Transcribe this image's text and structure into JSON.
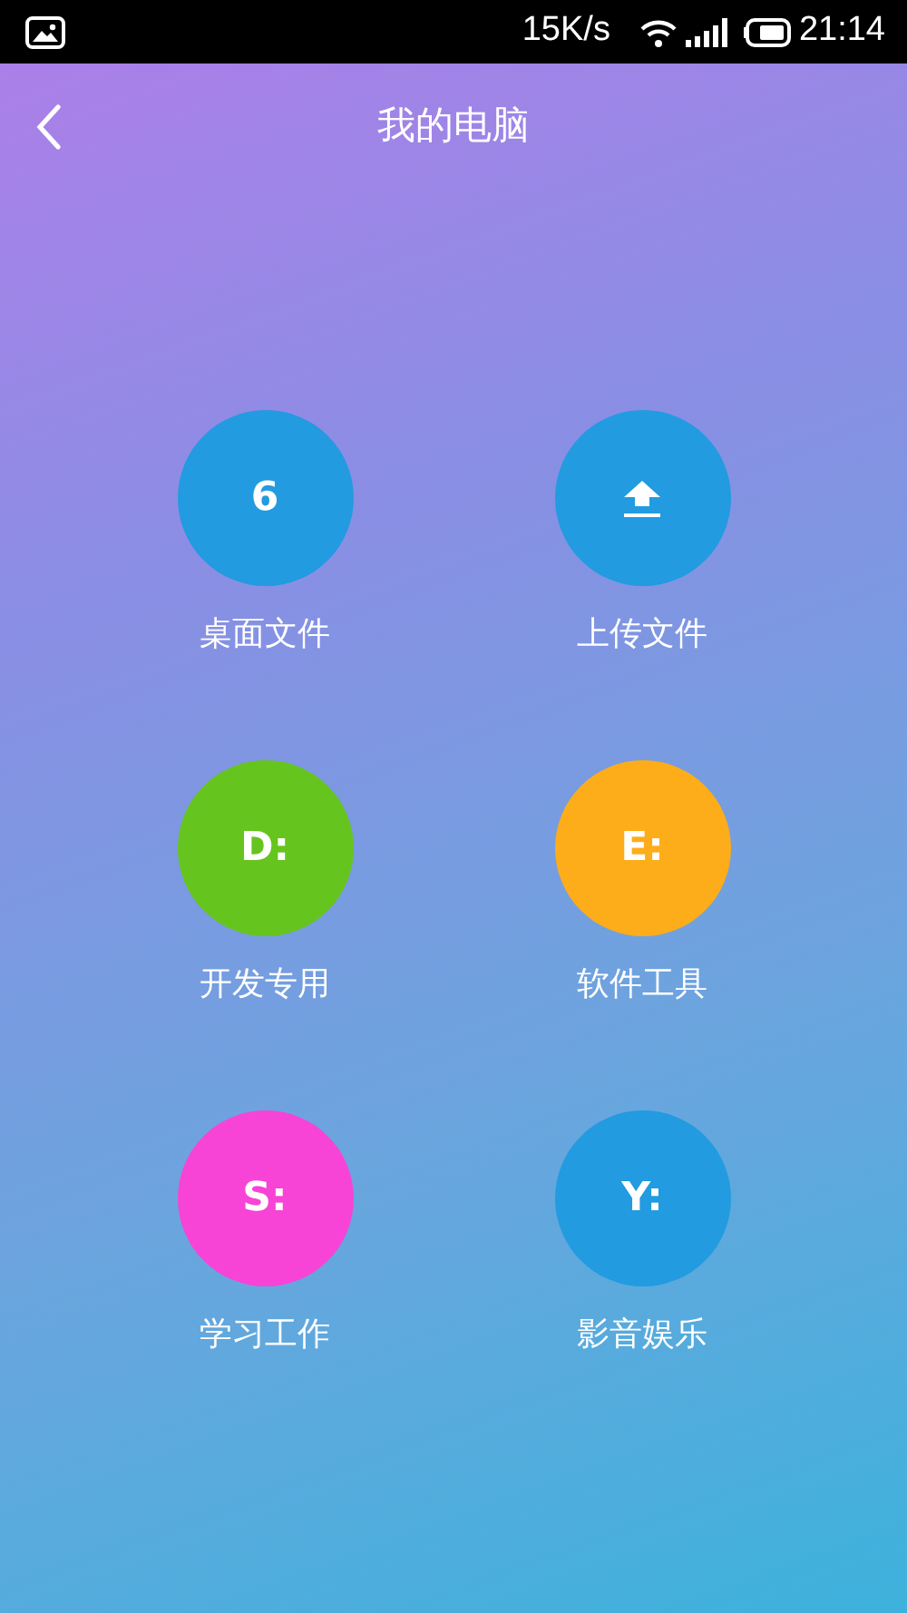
{
  "status_bar": {
    "speed": "15K/s",
    "time": "21:14"
  },
  "header": {
    "title": "我的电脑"
  },
  "drives": [
    {
      "kind": "text",
      "symbol": "6",
      "label": "桌面文件",
      "color": "#229be0"
    },
    {
      "kind": "upload",
      "label": "上传文件",
      "color": "#229be0"
    },
    {
      "kind": "text",
      "symbol": "D:",
      "label": "开发专用",
      "color": "#66c41e"
    },
    {
      "kind": "text",
      "symbol": "E:",
      "label": "软件工具",
      "color": "#fdad1a"
    },
    {
      "kind": "text",
      "symbol": "S:",
      "label": "学习工作",
      "color": "#f744d6"
    },
    {
      "kind": "text",
      "symbol": "Y:",
      "label": "影音娱乐",
      "color": "#229be0"
    }
  ]
}
